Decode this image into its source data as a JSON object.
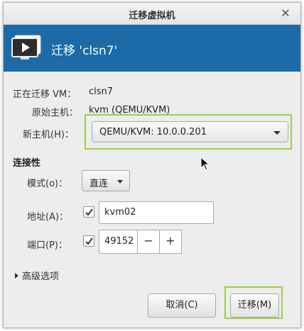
{
  "window": {
    "title": "迁移虚拟机"
  },
  "banner": {
    "title": "迁移 'clsn7'"
  },
  "info": {
    "migrating_label": "正在迁移 VM：",
    "migrating_value": "clsn7",
    "original_host_label": "原始主机：",
    "original_host_value": "kvm (QEMU/KVM)",
    "new_host_label": "新主机(H)：",
    "new_host_value": "QEMU/KVM: 10.0.0.201"
  },
  "connectivity": {
    "heading": "连接性",
    "mode_label": "模式(o)：",
    "mode_value": "直连",
    "address_label": "地址(A)：",
    "address_checked": true,
    "address_value": "kvm02",
    "port_label": "端口(P)：",
    "port_checked": true,
    "port_value": "49152",
    "port_minus": "−",
    "port_plus": "+"
  },
  "advanced": {
    "label": "高级选项"
  },
  "buttons": {
    "cancel": "取消(C)",
    "migrate": "迁移(M)"
  },
  "colors": {
    "banner": "#1c6aa8",
    "highlight": "#9ccf44"
  },
  "icons": {
    "close": "close-icon",
    "vm": "vm-display-icon",
    "cursor": "mouse-pointer-icon"
  }
}
